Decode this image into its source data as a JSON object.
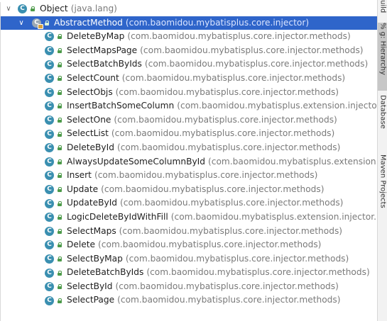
{
  "tree": {
    "root": {
      "name": "Object",
      "package": "(java.lang)",
      "expanded_glyph": "∨"
    },
    "selected": {
      "name": "AbstractMethod",
      "package": "(com.baomidou.mybatisplus.core.injector)",
      "expanded_glyph": "∨"
    },
    "class_icon_letter": "C",
    "children": [
      {
        "name": "DeleteByMap",
        "package": "(com.baomidou.mybatisplus.core.injector.methods)"
      },
      {
        "name": "SelectMapsPage",
        "package": "(com.baomidou.mybatisplus.core.injector.methods)"
      },
      {
        "name": "SelectBatchByIds",
        "package": "(com.baomidou.mybatisplus.core.injector.methods)"
      },
      {
        "name": "SelectCount",
        "package": "(com.baomidou.mybatisplus.core.injector.methods)"
      },
      {
        "name": "SelectObjs",
        "package": "(com.baomidou.mybatisplus.core.injector.methods)"
      },
      {
        "name": "InsertBatchSomeColumn",
        "package": "(com.baomidou.mybatisplus.extension.injector.methods.a"
      },
      {
        "name": "SelectOne",
        "package": "(com.baomidou.mybatisplus.core.injector.methods)"
      },
      {
        "name": "SelectList",
        "package": "(com.baomidou.mybatisplus.core.injector.methods)"
      },
      {
        "name": "DeleteById",
        "package": "(com.baomidou.mybatisplus.core.injector.methods)"
      },
      {
        "name": "AlwaysUpdateSomeColumnById",
        "package": "(com.baomidou.mybatisplus.extension.injector.me"
      },
      {
        "name": "Insert",
        "package": "(com.baomidou.mybatisplus.core.injector.methods)"
      },
      {
        "name": "Update",
        "package": "(com.baomidou.mybatisplus.core.injector.methods)"
      },
      {
        "name": "UpdateById",
        "package": "(com.baomidou.mybatisplus.core.injector.methods)"
      },
      {
        "name": "LogicDeleteByIdWithFill",
        "package": "(com.baomidou.mybatisplus.extension.injector.methods.ac"
      },
      {
        "name": "SelectMaps",
        "package": "(com.baomidou.mybatisplus.core.injector.methods)"
      },
      {
        "name": "Delete",
        "package": "(com.baomidou.mybatisplus.core.injector.methods)"
      },
      {
        "name": "SelectByMap",
        "package": "(com.baomidou.mybatisplus.core.injector.methods)"
      },
      {
        "name": "DeleteBatchByIds",
        "package": "(com.baomidou.mybatisplus.core.injector.methods)"
      },
      {
        "name": "SelectById",
        "package": "(com.baomidou.mybatisplus.core.injector.methods)"
      },
      {
        "name": "SelectPage",
        "package": "(com.baomidou.mybatisplus.core.injector.methods)"
      }
    ]
  },
  "side_tabs": {
    "top_label": "uild",
    "hierarchy_label": "% g: Hierarchy",
    "database_label": "Database",
    "maven_label": "Maven Projects"
  },
  "colors": {
    "selection": "#2f65ca",
    "class_icon": "#3a8fb0",
    "package_text": "#7a7a7a"
  }
}
